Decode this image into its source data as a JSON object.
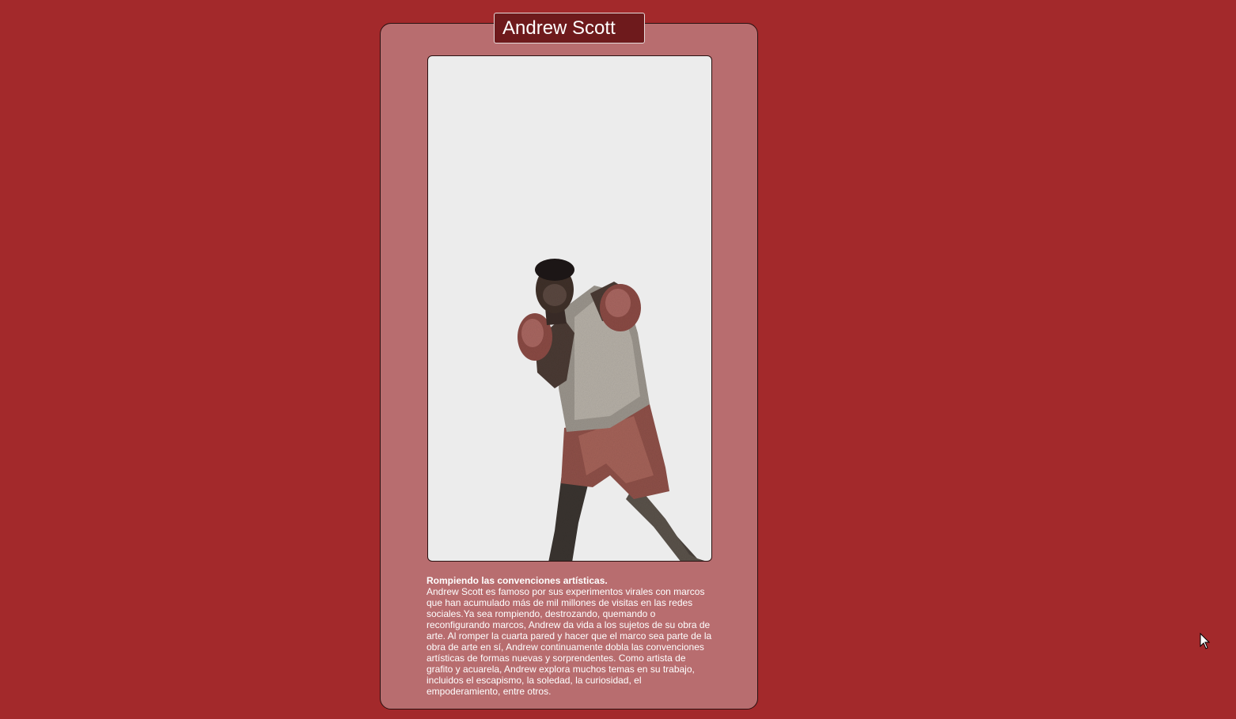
{
  "artist": {
    "name": "Andrew Scott"
  },
  "artwork": {
    "subject_icon": "boxer-illustration"
  },
  "description": {
    "headline": "Rompiendo las convenciones artísticas.",
    "body": "Andrew Scott es famoso por sus experimentos virales con marcos que han acumulado más de mil millones de visitas en las redes sociales.Ya sea rompiendo, destrozando, quemando o reconfigurando marcos, Andrew da vida a los sujetos de su obra de arte. Al romper la cuarta pared y hacer que el marco sea parte de la obra de arte en sí, Andrew continuamente dobla las convenciones artísticas de formas nuevas y sorprendentes. Como artista de grafito y acuarela, Andrew explora muchos temas en su trabajo, incluidos el escapismo, la soledad, la curiosidad, el empoderamiento, entre otros."
  },
  "colors": {
    "page_background": "#a3292b",
    "card_background": "#b86d6f",
    "name_box_background": "#6e1a1c",
    "frame_background": "#ececec"
  }
}
